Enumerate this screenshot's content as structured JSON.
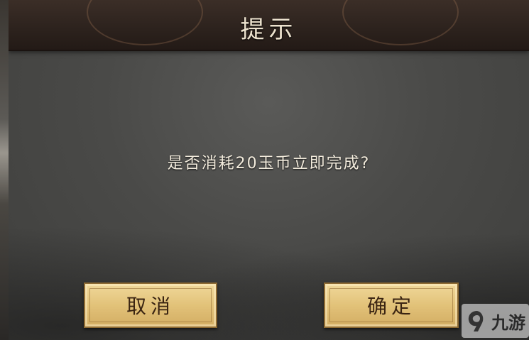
{
  "dialog": {
    "title": "提示",
    "message": "是否消耗20玉币立即完成?"
  },
  "buttons": {
    "cancel_label": "取消",
    "confirm_label": "确定"
  },
  "watermark": {
    "text": "九游",
    "icon": "jiuyou-logo-icon"
  },
  "colors": {
    "title_bar": "#2c221d",
    "panel": "#4a4a48",
    "button_gold": "#e2c279",
    "button_text": "#3a2412",
    "text_light": "#f2ebdc"
  }
}
